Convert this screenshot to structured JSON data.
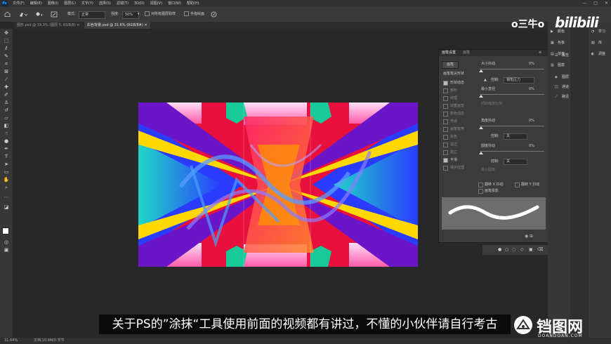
{
  "menubar": {
    "logo": "Ps",
    "items": [
      "文件(F)",
      "编辑(E)",
      "图像(I)",
      "图层(L)",
      "文字(Y)",
      "选择(S)",
      "滤镜(T)",
      "3D(D)",
      "视图(V)",
      "窗口(W)",
      "帮助(H)"
    ],
    "window_controls": [
      "—",
      "□",
      "✕"
    ]
  },
  "options": {
    "mode_label": "模式:",
    "mode_value": "正常",
    "strength_label": "强度:",
    "strength_value": "50%",
    "sample_all_label": "对所有图层取样",
    "finger_paint_label": "手指绘画"
  },
  "tabs": [
    {
      "label": "图形.psd @ 33.3% (图层 5, RGB/8) ✕",
      "active": false
    },
    {
      "label": "彩色背景.psd @ 31.6% (RGB/8#) ✕",
      "active": true
    }
  ],
  "watermark": {
    "channel": "o三牛o",
    "site": "bilibili"
  },
  "properties_panel": {
    "tabs": [
      "画笔设置",
      "画笔"
    ],
    "preset_button": "画笔",
    "tip_shape_label": "画笔笔尖形状",
    "options": [
      {
        "label": "形状动态",
        "checked": true
      },
      {
        "label": "散布",
        "checked": false
      },
      {
        "label": "纹理",
        "checked": false
      },
      {
        "label": "双重画笔",
        "checked": false
      },
      {
        "label": "颜色动态",
        "checked": false
      },
      {
        "label": "传递",
        "checked": false
      },
      {
        "label": "画笔笔势",
        "checked": false
      },
      {
        "label": "杂色",
        "checked": false
      },
      {
        "label": "湿边",
        "checked": false
      },
      {
        "label": "建立",
        "checked": false
      },
      {
        "label": "平滑",
        "checked": true
      },
      {
        "label": "保护纹理",
        "checked": false
      }
    ],
    "size_jitter_label": "大小抖动",
    "size_jitter_value": "0%",
    "control_label": "控制:",
    "control_value": "钢笔压力",
    "min_diameter_label": "最小直径",
    "min_diameter_value": "0%",
    "tilt_scale_label": "倾斜缩放比例",
    "angle_jitter_label": "角度抖动",
    "angle_jitter_value": "0%",
    "control2_value": "关",
    "roundness_jitter_label": "圆度抖动",
    "roundness_jitter_value": "0%",
    "control3_value": "关",
    "min_roundness_label": "最小圆度",
    "flip_x_label": "翻转 X 抖动",
    "flip_y_label": "翻转 Y 抖动",
    "brush_projection_label": "画笔投影"
  },
  "dock": {
    "col1_items": [
      "颜色",
      "色板",
      "渐变",
      "图案"
    ],
    "col2_items": [
      "学习",
      "库",
      "调整"
    ],
    "col3_items": [
      "属性",
      "图层",
      "通道",
      "路径"
    ]
  },
  "subtitle": "关于PS的”涂抹“工具使用前面的视频都有讲过，不懂的小伙伴请自行考古",
  "status": {
    "zoom": "31.64%",
    "doc": "文档:10.9M/0 字节"
  },
  "brand": {
    "name": "铛图网",
    "domain": "DOANDOAN.COM"
  },
  "colors": {
    "accent": "#31a8ff",
    "panel": "#3b3b3b"
  }
}
